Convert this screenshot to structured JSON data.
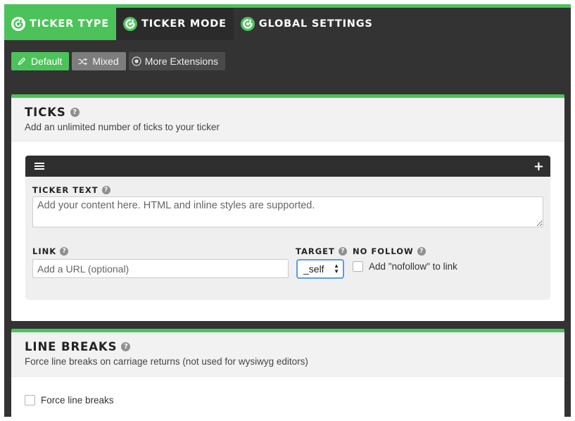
{
  "tabs": [
    {
      "label": "TICKER TYPE",
      "icon": "ditty-logo-icon",
      "active": true
    },
    {
      "label": "TICKER MODE",
      "icon": "ditty-logo-icon",
      "active": false
    },
    {
      "label": "GLOBAL SETTINGS",
      "icon": "ditty-logo-icon",
      "active": false
    }
  ],
  "type_buttons": {
    "default": {
      "label": "Default",
      "icon": "pencil-icon"
    },
    "mixed": {
      "label": "Mixed",
      "icon": "shuffle-icon"
    },
    "extensions": {
      "label": "More Extensions",
      "icon": "plus-circle-icon"
    }
  },
  "ticks": {
    "title": "TICKS",
    "description": "Add an unlimited number of ticks to your ticker",
    "ticker_text": {
      "label": "TICKER TEXT",
      "placeholder": "Add your content here. HTML and inline styles are supported."
    },
    "link": {
      "label": "LINK",
      "placeholder": "Add a URL (optional)"
    },
    "target": {
      "label": "TARGET",
      "value": "_self"
    },
    "no_follow": {
      "label": "NO FOLLOW",
      "checkbox_label": "Add \"nofollow\" to link",
      "checked": false
    }
  },
  "line_breaks": {
    "title": "LINE BREAKS",
    "description": "Force line breaks on carriage returns (not used for wysiwyg editors)",
    "checkbox_label": "Force line breaks",
    "checked": false
  },
  "colors": {
    "accent": "#4cc35a",
    "dark": "#333333",
    "focus": "#5b9ddd"
  }
}
